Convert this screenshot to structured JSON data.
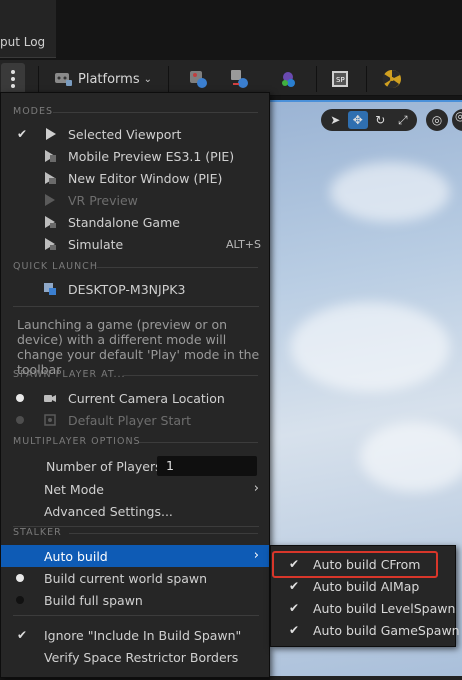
{
  "tab": {
    "label": "put Log"
  },
  "toolbar": {
    "platforms_label": "Platforms",
    "icons": [
      "kebab-icon",
      "platforms-icon",
      "content-icon",
      "blueprint-icon",
      "cinematics-icon",
      "source-control-icon",
      "build-icon"
    ]
  },
  "viewport": {
    "tools": [
      "select-icon",
      "translate-icon",
      "rotate-icon",
      "scale-icon",
      "world-local-icon",
      "snap-icon"
    ]
  },
  "menu": {
    "sections": {
      "modes": "MODES",
      "quick_launch": "QUICK LAUNCH",
      "spawn_player": "SPAWN PLAYER AT...",
      "multiplayer": "MULTIPLAYER OPTIONS",
      "stalker": "STALKER"
    },
    "modes": [
      {
        "label": "Selected Viewport",
        "checked": true
      },
      {
        "label": "Mobile Preview ES3.1 (PIE)",
        "checked": false
      },
      {
        "label": "New Editor Window (PIE)",
        "checked": false
      },
      {
        "label": "VR Preview",
        "disabled": true
      },
      {
        "label": "Standalone Game",
        "checked": false
      },
      {
        "label": "Simulate",
        "shortcut": "ALT+S"
      }
    ],
    "quick_launch": [
      {
        "label": "DESKTOP-M3NJPK3"
      }
    ],
    "info_text": "Launching a game (preview or on device) with a different mode will change your default 'Play' mode in the toolbar",
    "spawn": [
      {
        "label": "Current Camera Location",
        "selected": true
      },
      {
        "label": "Default Player Start",
        "disabled": true
      }
    ],
    "multiplayer": {
      "num_players_label": "Number of Players",
      "num_players_value": "1",
      "net_mode_label": "Net Mode",
      "advanced_label": "Advanced Settings..."
    },
    "stalker": {
      "auto_build_label": "Auto build",
      "build_current_label": "Build current world spawn",
      "build_full_label": "Build full spawn",
      "ignore_label": "Ignore \"Include In Build Spawn\"",
      "verify_label": "Verify Space Restrictor Borders"
    }
  },
  "submenu": {
    "items": [
      {
        "label": "Auto build CFrom",
        "checked": true
      },
      {
        "label": "Auto build AIMap",
        "checked": true
      },
      {
        "label": "Auto build LevelSpawn",
        "checked": true
      },
      {
        "label": "Auto build GameSpawn",
        "checked": true
      }
    ]
  },
  "colors": {
    "menu_bg": "#262626",
    "highlight": "#0e5bb5",
    "annotation_box": "#d8362a",
    "viewport_accent": "#4a90d9"
  }
}
